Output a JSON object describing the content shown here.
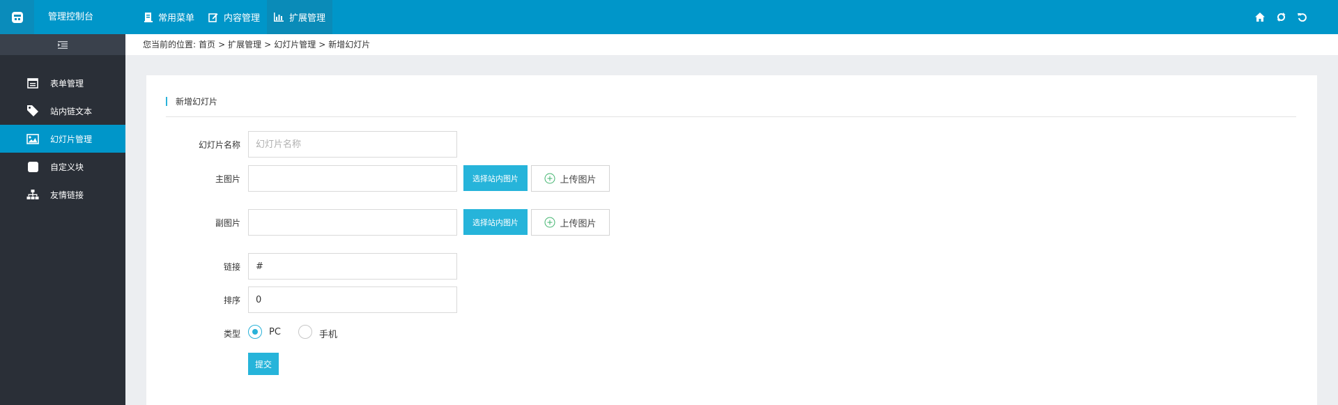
{
  "header": {
    "app_title": "管理控制台",
    "nav": [
      {
        "label": "常用菜单",
        "icon": "document-icon"
      },
      {
        "label": "内容管理",
        "icon": "edit-icon"
      },
      {
        "label": "扩展管理",
        "icon": "bar-chart-icon"
      }
    ],
    "right_icons": [
      "home-icon",
      "refresh-icon",
      "undo-icon"
    ]
  },
  "sidebar": {
    "items": [
      {
        "label": "表单管理",
        "icon": "form-icon"
      },
      {
        "label": "站内链文本",
        "icon": "tag-icon"
      },
      {
        "label": "幻灯片管理",
        "icon": "image-icon"
      },
      {
        "label": "自定义块",
        "icon": "square-icon"
      },
      {
        "label": "友情链接",
        "icon": "sitemap-icon"
      }
    ],
    "active_index": 2
  },
  "breadcrumb": {
    "prefix": "您当前的位置:",
    "items": [
      "首页",
      "扩展管理",
      "幻灯片管理",
      "新增幻灯片"
    ],
    "separator": ">"
  },
  "form": {
    "title": "新增幻灯片",
    "name": {
      "label": "幻灯片名称",
      "placeholder": "幻灯片名称",
      "value": ""
    },
    "main_image": {
      "label": "主图片",
      "value": "",
      "choose_label": "选择站内图片",
      "upload_label": "上传图片"
    },
    "sub_image": {
      "label": "副图片",
      "value": "",
      "choose_label": "选择站内图片",
      "upload_label": "上传图片"
    },
    "link": {
      "label": "链接",
      "value": "#"
    },
    "sort": {
      "label": "排序",
      "value": "0"
    },
    "type": {
      "label": "类型",
      "options": [
        "PC",
        "手机"
      ],
      "selected": "PC"
    },
    "submit_label": "提交"
  },
  "colors": {
    "topbar": "#0096c9",
    "sidebar": "#2a2f37",
    "accent": "#26b4da"
  }
}
